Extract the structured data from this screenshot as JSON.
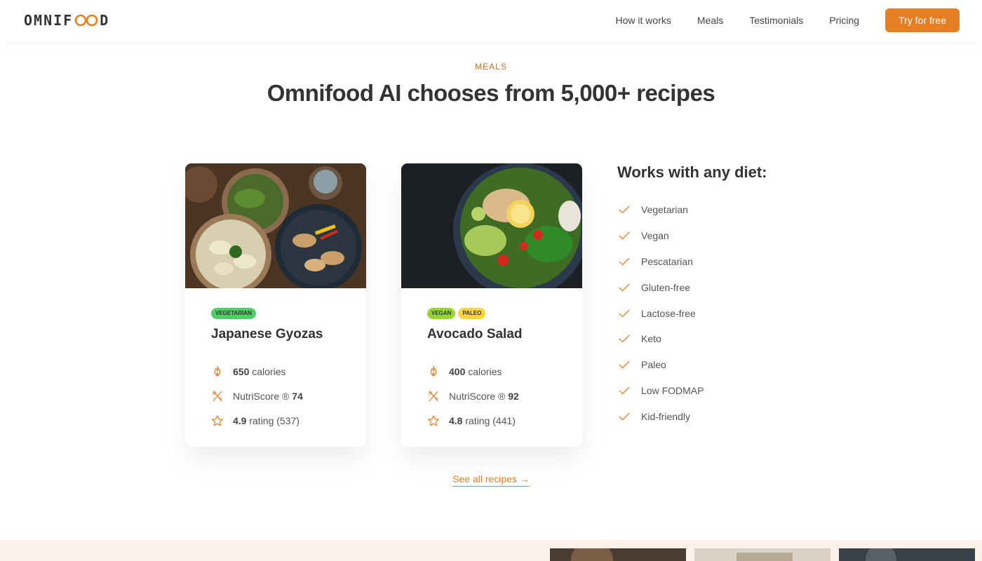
{
  "header": {
    "logo_left": "OMNIF",
    "logo_right": "D",
    "nav": [
      "How it works",
      "Meals",
      "Testimonials",
      "Pricing"
    ],
    "cta": "Try for free"
  },
  "section": {
    "subheading": "MEALS",
    "heading": "Omnifood AI chooses from 5,000+ recipes"
  },
  "meals": [
    {
      "tags": [
        "VEGETARIAN"
      ],
      "title": "Japanese Gyozas",
      "calories_value": "650",
      "calories_label": "calories",
      "nutri_label": "NutriScore ®",
      "nutri_value": "74",
      "rating_value": "4.9",
      "rating_label": "rating (537)"
    },
    {
      "tags": [
        "VEGAN",
        "PALEO"
      ],
      "title": "Avocado Salad",
      "calories_value": "400",
      "calories_label": "calories",
      "nutri_label": "NutriScore ®",
      "nutri_value": "92",
      "rating_value": "4.8",
      "rating_label": "rating (441)"
    }
  ],
  "diets": {
    "title": "Works with any diet:",
    "items": [
      "Vegetarian",
      "Vegan",
      "Pescatarian",
      "Gluten-free",
      "Lactose-free",
      "Keto",
      "Paleo",
      "Low FODMAP",
      "Kid-friendly"
    ]
  },
  "link": {
    "all_recipes": "See all recipes →"
  },
  "colors": {
    "accent": "#e67e22",
    "accent_dark": "#cf711f",
    "tag_vegetarian": "#51cf66",
    "tag_vegan": "#94d82d",
    "tag_paleo": "#ffd43b",
    "band": "#fdf2e9"
  },
  "icons": {
    "calories": "flame-icon",
    "nutriscore": "utensils-icon",
    "rating": "star-icon",
    "diet": "check-icon"
  }
}
